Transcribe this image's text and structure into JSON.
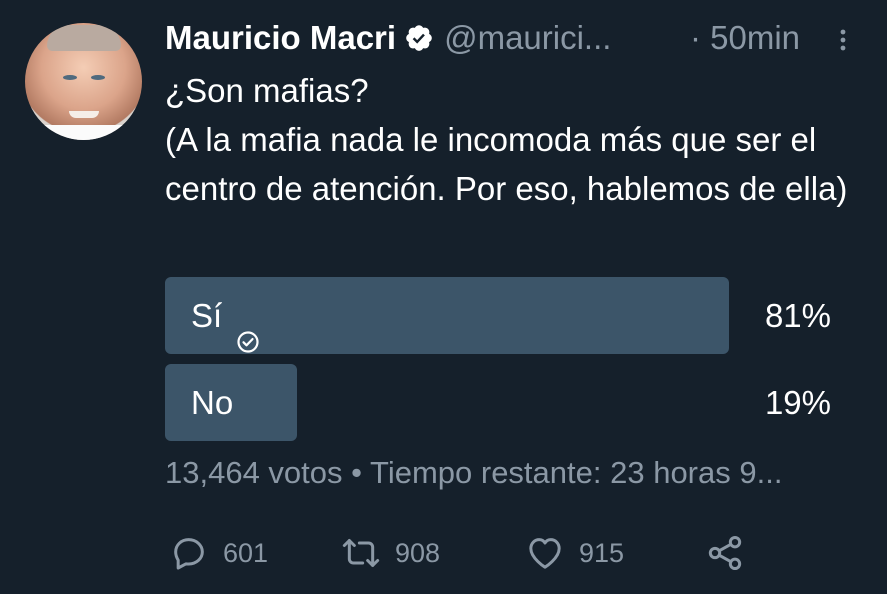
{
  "author": {
    "name": "Mauricio Macri",
    "handle": "@maurici...",
    "time": "· 50min",
    "verified_icon": "verified-badge-icon",
    "avatar_icon": "avatar"
  },
  "tweet": {
    "lines": [
      "¿Son mafias?",
      "(A la mafia nada le incomoda más que ser el centro de atención. Por eso, hablemos de ella)"
    ]
  },
  "poll": {
    "options": [
      {
        "label": "Sí",
        "percent_text": "81%",
        "percent": 81,
        "selected": true
      },
      {
        "label": "No",
        "percent_text": "19%",
        "percent": 19,
        "selected": false
      }
    ],
    "meta": "13,464 votos • Tiempo restante: 23 horas 9..."
  },
  "actions": {
    "reply_count": "601",
    "retweet_count": "908",
    "like_count": "915"
  },
  "colors": {
    "background": "#15202b",
    "text": "#ffffff",
    "muted": "#8b98a5",
    "poll_bar": "#3c5569"
  }
}
